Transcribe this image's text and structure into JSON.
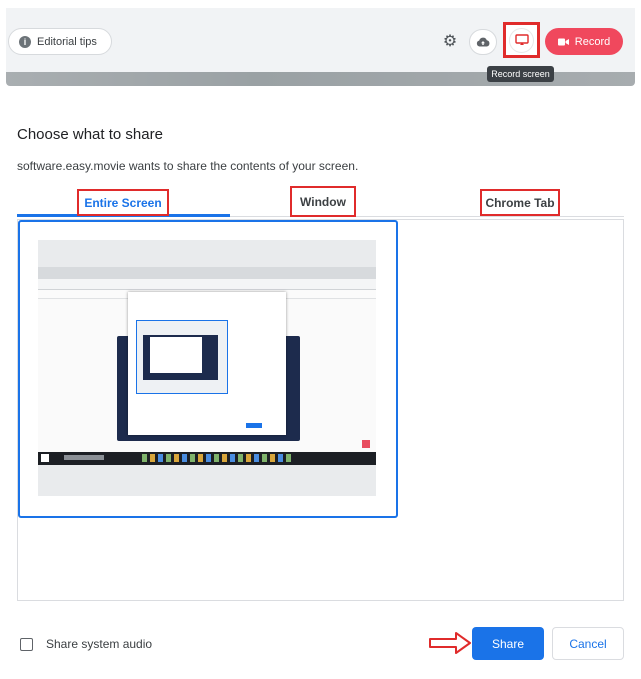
{
  "toolbar": {
    "tips_label": "Editorial tips",
    "record_label": "Record",
    "tooltip": "Record screen"
  },
  "dialog": {
    "title": "Choose what to share",
    "subtitle": "software.easy.movie wants to share the contents of your screen.",
    "tabs": [
      {
        "label": "Entire Screen",
        "active": true
      },
      {
        "label": "Window",
        "active": false
      },
      {
        "label": "Chrome Tab",
        "active": false
      }
    ],
    "audio_label": "Share system audio",
    "share_label": "Share",
    "cancel_label": "Cancel"
  },
  "colors": {
    "accent": "#1a73e8",
    "record": "#f0485d",
    "highlight": "#e02b2b"
  }
}
